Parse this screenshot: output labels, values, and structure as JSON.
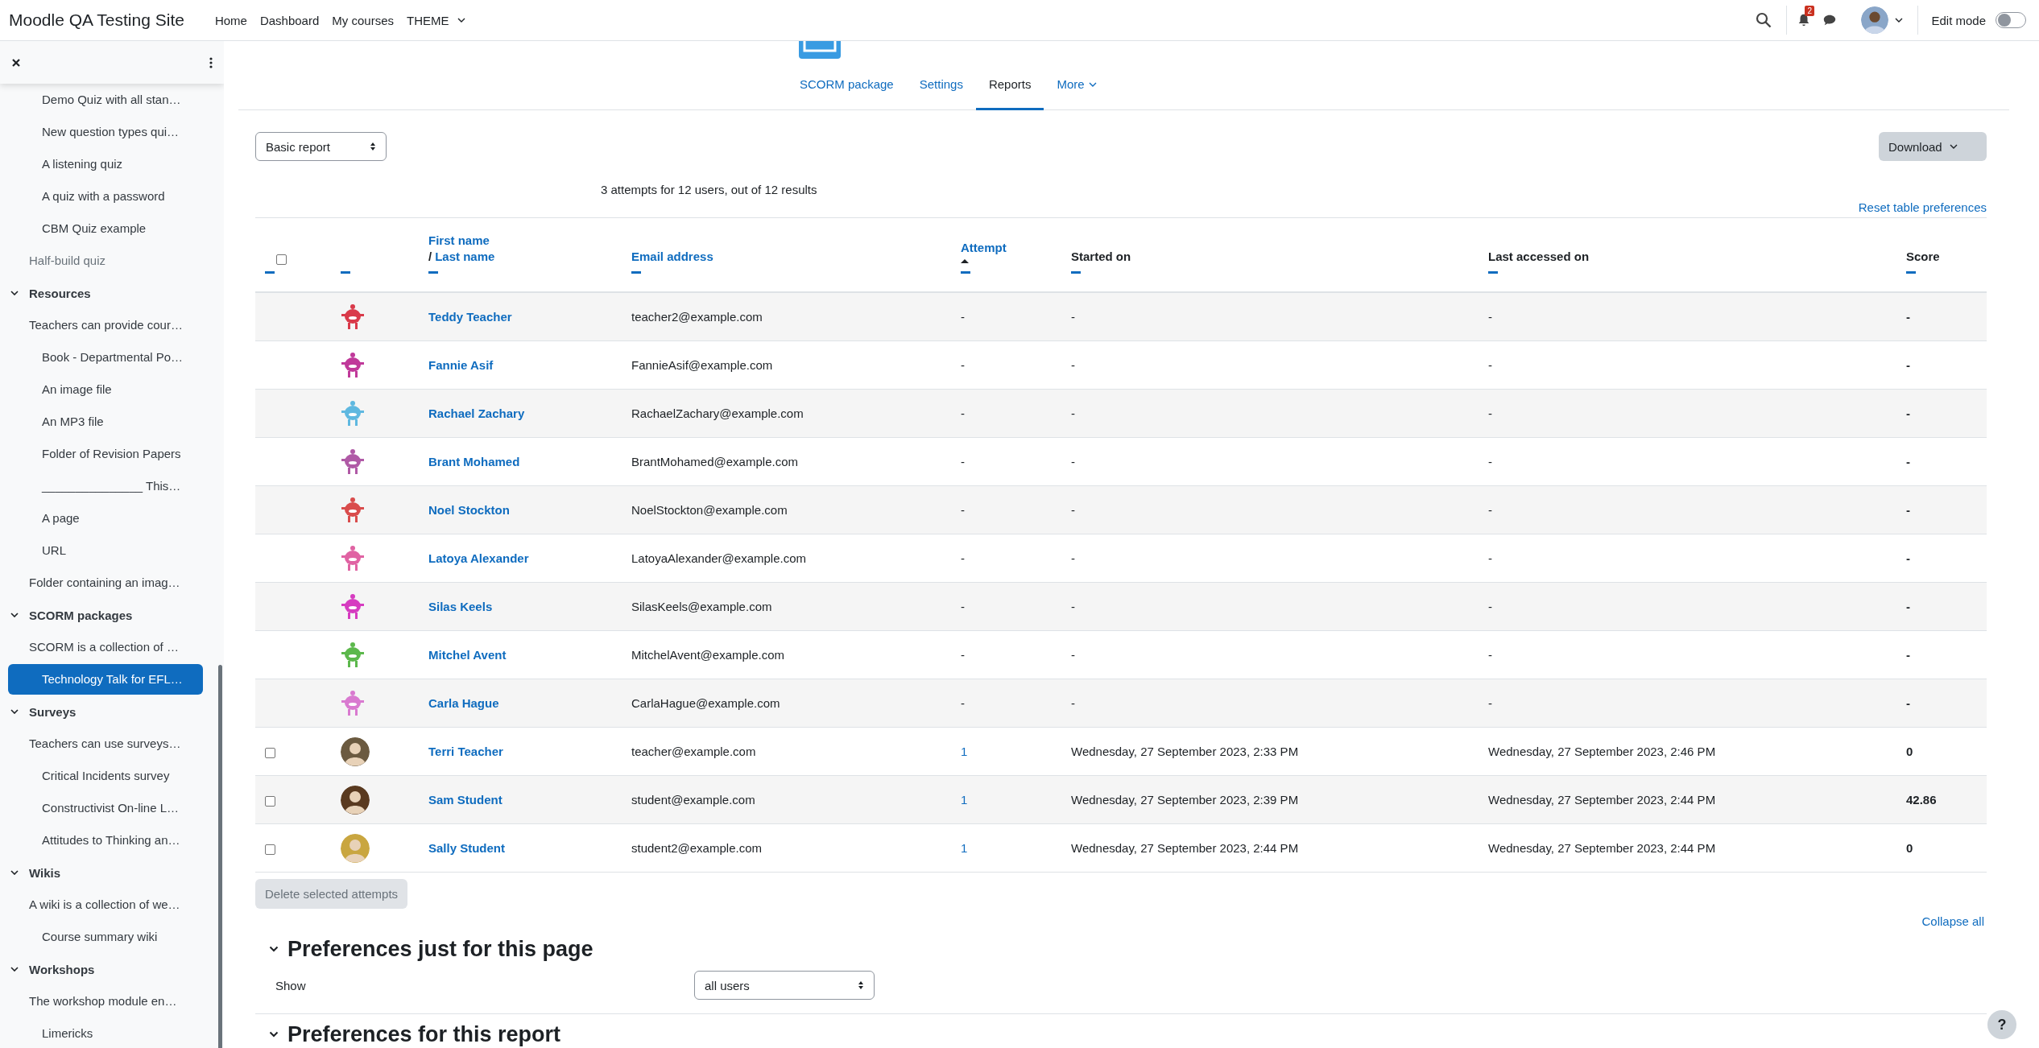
{
  "navbar": {
    "site_name": "Moodle QA Testing Site",
    "links": [
      {
        "label": "Home",
        "dropdown": false
      },
      {
        "label": "Dashboard",
        "dropdown": false
      },
      {
        "label": "My courses",
        "dropdown": false
      },
      {
        "label": "THEME",
        "dropdown": true
      }
    ],
    "notification_count": "2",
    "edit_mode": {
      "label": "Edit mode",
      "on": false
    }
  },
  "sidebar": {
    "sections": [
      {
        "items": [
          {
            "children": [
              {
                "label": "Demo Quiz with all stan…",
                "selected": false,
                "dimmed": false
              },
              {
                "label": "New question types qui…",
                "selected": false,
                "dimmed": false
              },
              {
                "label": "A listening quiz",
                "selected": false,
                "dimmed": false
              },
              {
                "label": "A quiz with a password",
                "selected": false,
                "dimmed": false
              },
              {
                "label": "CBM Quiz example",
                "selected": false,
                "dimmed": false
              }
            ]
          },
          {
            "label": "Half-build quiz",
            "selected": false,
            "dimmed": true
          }
        ]
      },
      {
        "title": "Resources",
        "expanded": true,
        "items": [
          {
            "label": "Teachers can provide cour…",
            "selected": false,
            "dimmed": false,
            "children": [
              {
                "label": "Book - Departmental Po…",
                "selected": false,
                "dimmed": false
              },
              {
                "label": "An image file",
                "selected": false,
                "dimmed": false
              },
              {
                "label": "An MP3 file",
                "selected": false,
                "dimmed": false
              },
              {
                "label": "Folder of Revision Papers",
                "selected": false,
                "dimmed": false
              },
              {
                "label": "_______________ This…",
                "selected": false,
                "dimmed": false
              },
              {
                "label": "A page",
                "selected": false,
                "dimmed": false
              },
              {
                "label": "URL",
                "selected": false,
                "dimmed": false
              }
            ]
          },
          {
            "label": "Folder containing an imag…",
            "selected": false,
            "dimmed": false
          }
        ]
      },
      {
        "title": "SCORM packages",
        "expanded": true,
        "items": [
          {
            "label": "SCORM is a collection of …",
            "selected": false,
            "dimmed": false,
            "children": [
              {
                "label": "Technology Talk for EFL…",
                "selected": true,
                "dimmed": false
              }
            ]
          }
        ]
      },
      {
        "title": "Surveys",
        "expanded": true,
        "items": [
          {
            "label": "Teachers can use surveys…",
            "selected": false,
            "dimmed": false,
            "children": [
              {
                "label": "Critical Incidents survey",
                "selected": false,
                "dimmed": false
              },
              {
                "label": "Constructivist On-line L…",
                "selected": false,
                "dimmed": false
              },
              {
                "label": "Attitudes to Thinking an…",
                "selected": false,
                "dimmed": false
              }
            ]
          }
        ]
      },
      {
        "title": "Wikis",
        "expanded": true,
        "items": [
          {
            "label": "A wiki is a collection of we…",
            "selected": false,
            "dimmed": false,
            "children": [
              {
                "label": "Course summary wiki",
                "selected": false,
                "dimmed": false
              }
            ]
          }
        ]
      },
      {
        "title": "Workshops",
        "expanded": true,
        "items": [
          {
            "label": "The workshop module en…",
            "selected": false,
            "dimmed": false,
            "children": [
              {
                "label": "Limericks",
                "selected": false,
                "dimmed": false
              }
            ]
          }
        ]
      }
    ]
  },
  "tabs": [
    {
      "label": "SCORM package",
      "selected": false,
      "dropdown": false
    },
    {
      "label": "Settings",
      "selected": false,
      "dropdown": false
    },
    {
      "label": "Reports",
      "selected": true,
      "dropdown": false
    },
    {
      "label": "More",
      "selected": false,
      "dropdown": true
    }
  ],
  "report_select": {
    "value": "Basic report"
  },
  "download_button": "Download",
  "summary": "3 attempts for 12 users, out of 12 results",
  "reset_link": "Reset table preferences",
  "table": {
    "columns": [
      {
        "kind": "checkbox",
        "checked": false,
        "sorted": false
      },
      {
        "kind": "blank",
        "sorted": false
      },
      {
        "kind": "name",
        "label": "First name",
        "separator": "/",
        "label_2": "Last name",
        "sorted": false
      },
      {
        "kind": "link",
        "label": "Email address",
        "sorted": false
      },
      {
        "kind": "link",
        "label": "Attempt",
        "sorted": true
      },
      {
        "kind": "plain",
        "label": "Started on",
        "sorted": false
      },
      {
        "kind": "plain",
        "label": "Last accessed on",
        "sorted": false
      },
      {
        "kind": "plain",
        "label": "Score",
        "sorted": false
      }
    ],
    "rows": [
      {
        "kind": "no_attempt",
        "avatar": {
          "kind": "monster",
          "color": "#d93a4a"
        },
        "name": "Teddy Teacher",
        "email": "teacher2@example.com",
        "attempt": "-",
        "started_on": "-",
        "last_accessed": "-",
        "score": "-"
      },
      {
        "kind": "no_attempt",
        "avatar": {
          "kind": "monster",
          "color": "#c0399a"
        },
        "name": "Fannie Asif",
        "email": "FannieAsif@example.com",
        "attempt": "-",
        "started_on": "-",
        "last_accessed": "-",
        "score": "-"
      },
      {
        "kind": "no_attempt",
        "avatar": {
          "kind": "monster",
          "color": "#5fb8e0"
        },
        "name": "Rachael Zachary",
        "email": "RachaelZachary@example.com",
        "attempt": "-",
        "started_on": "-",
        "last_accessed": "-",
        "score": "-"
      },
      {
        "kind": "no_attempt",
        "avatar": {
          "kind": "monster",
          "color": "#b05aa6"
        },
        "name": "Brant Mohamed",
        "email": "BrantMohamed@example.com",
        "attempt": "-",
        "started_on": "-",
        "last_accessed": "-",
        "score": "-"
      },
      {
        "kind": "no_attempt",
        "avatar": {
          "kind": "monster",
          "color": "#d94c4c"
        },
        "name": "Noel Stockton",
        "email": "NoelStockton@example.com",
        "attempt": "-",
        "started_on": "-",
        "last_accessed": "-",
        "score": "-"
      },
      {
        "kind": "no_attempt",
        "avatar": {
          "kind": "monster",
          "color": "#e063a3"
        },
        "name": "Latoya Alexander",
        "email": "LatoyaAlexander@example.com",
        "attempt": "-",
        "started_on": "-",
        "last_accessed": "-",
        "score": "-"
      },
      {
        "kind": "no_attempt",
        "avatar": {
          "kind": "monster",
          "color": "#d63cc0"
        },
        "name": "Silas Keels",
        "email": "SilasKeels@example.com",
        "attempt": "-",
        "started_on": "-",
        "last_accessed": "-",
        "score": "-"
      },
      {
        "kind": "no_attempt",
        "avatar": {
          "kind": "monster",
          "color": "#5cb84c"
        },
        "name": "Mitchel Avent",
        "email": "MitchelAvent@example.com",
        "attempt": "-",
        "started_on": "-",
        "last_accessed": "-",
        "score": "-"
      },
      {
        "kind": "no_attempt",
        "avatar": {
          "kind": "monster",
          "color": "#d97ad0"
        },
        "name": "Carla Hague",
        "email": "CarlaHague@example.com",
        "attempt": "-",
        "started_on": "-",
        "last_accessed": "-",
        "score": "-"
      },
      {
        "kind": "attempt",
        "checked": false,
        "avatar": {
          "kind": "photo",
          "color": "#6b5a40"
        },
        "name": "Terri Teacher",
        "email": "teacher@example.com",
        "attempt": "1",
        "started_on": "Wednesday, 27 September 2023, 2:33 PM",
        "last_accessed": "Wednesday, 27 September 2023, 2:46 PM",
        "score": "0"
      },
      {
        "kind": "attempt",
        "checked": false,
        "avatar": {
          "kind": "photo",
          "color": "#5a3a20"
        },
        "name": "Sam Student",
        "email": "student@example.com",
        "attempt": "1",
        "started_on": "Wednesday, 27 September 2023, 2:39 PM",
        "last_accessed": "Wednesday, 27 September 2023, 2:44 PM",
        "score": "42.86"
      },
      {
        "kind": "attempt",
        "checked": false,
        "avatar": {
          "kind": "photo",
          "color": "#c9a640"
        },
        "name": "Sally Student",
        "email": "student2@example.com",
        "attempt": "1",
        "started_on": "Wednesday, 27 September 2023, 2:44 PM",
        "last_accessed": "Wednesday, 27 September 2023, 2:44 PM",
        "score": "0"
      }
    ]
  },
  "delete_button": {
    "label": "Delete selected attempts",
    "disabled": true
  },
  "collapse_all": "Collapse all",
  "preferences": [
    {
      "title": "Preferences just for this page",
      "expanded": true,
      "fields": [
        {
          "label": "Show",
          "value": "all users"
        }
      ]
    },
    {
      "title": "Preferences for this report",
      "expanded": true
    }
  ],
  "help_button": "?"
}
